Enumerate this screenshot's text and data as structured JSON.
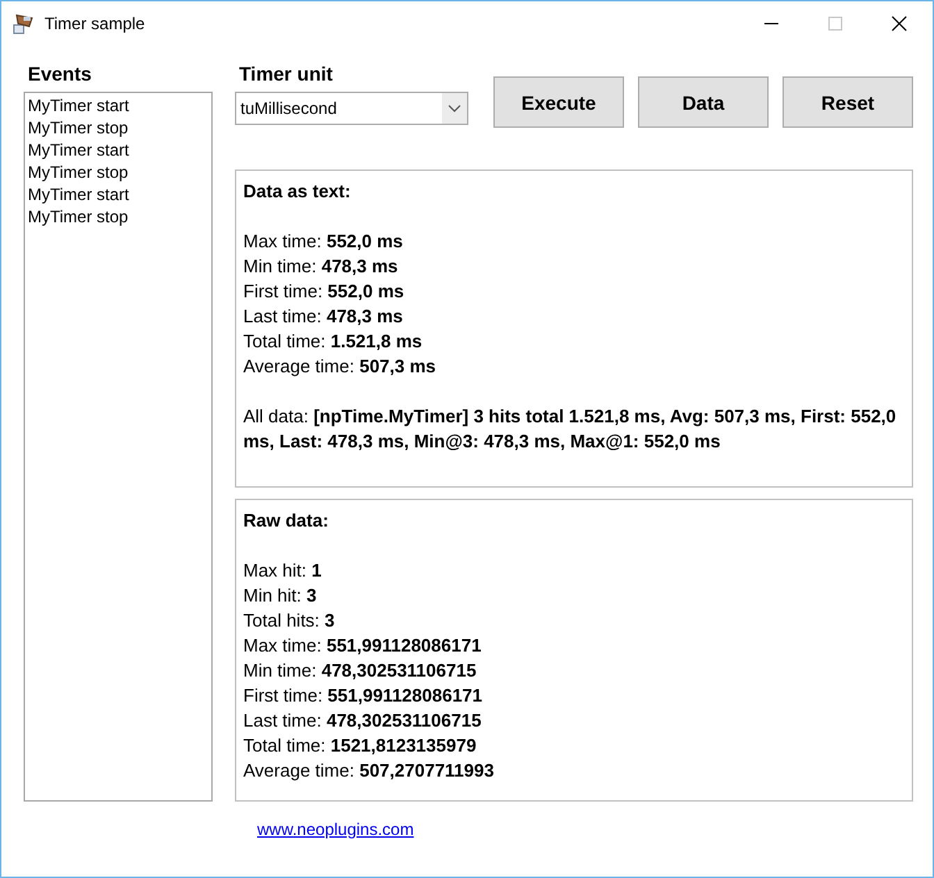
{
  "window": {
    "title": "Timer sample",
    "maximize_disabled": true
  },
  "events": {
    "label": "Events",
    "items": [
      "MyTimer start",
      "MyTimer stop",
      "MyTimer start",
      "MyTimer stop",
      "MyTimer start",
      "MyTimer stop"
    ]
  },
  "timer_unit": {
    "label": "Timer unit",
    "value": "tuMillisecond"
  },
  "buttons": [
    "Execute",
    "Data",
    "Reset"
  ],
  "text_panel": {
    "heading": "Data as text:",
    "lines": [
      "Max time: **552,0 ms**",
      "Min time: **478,3 ms**",
      "First time: **552,0 ms**",
      "Last time: **478,3 ms**",
      "Total time: **1.521,8 ms**",
      "Average time: **507,3 ms**"
    ],
    "all_data": "All data: **[npTime.MyTimer] 3 hits total 1.521,8 ms, Avg: 507,3 ms, First: 552,0 ms, Last: 478,3 ms, Min@3: 478,3 ms, Max@1: 552,0 ms**"
  },
  "raw_panel": {
    "heading": "Raw data:",
    "lines": [
      "Max hit: **1**",
      "Min hit: **3**",
      "Total hits: **3**",
      "Max time: **551,991128086171**",
      "Min time: **478,302531106715**",
      "First time: **551,991128086171**",
      "Last time: **478,302531106715**",
      "Total time: **1521,8123135979**",
      "Average time: **507,2707711993**"
    ]
  },
  "link": "www.neoplugins.com"
}
